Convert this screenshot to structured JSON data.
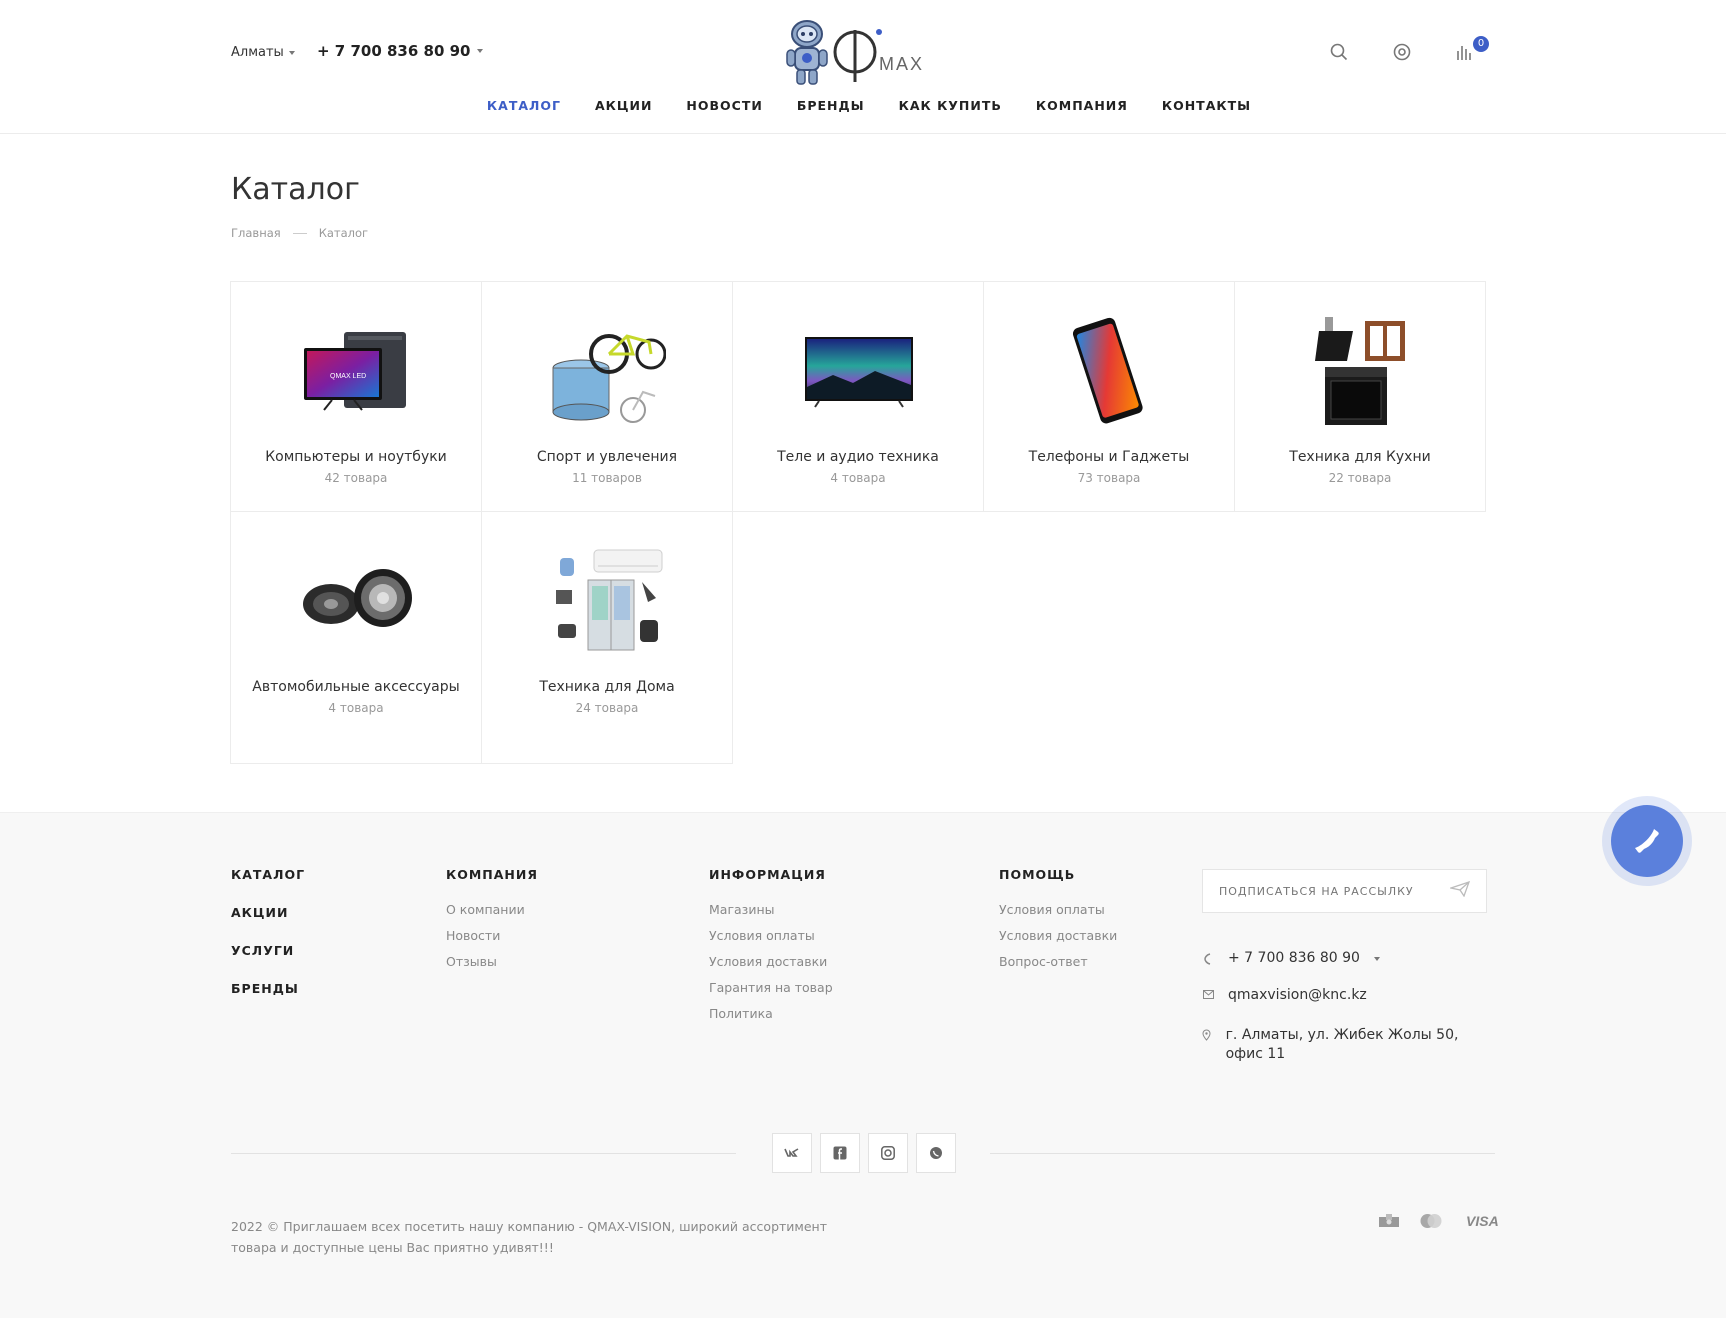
{
  "header": {
    "city": "Алматы",
    "phone": "+ 7 700 836 80 90",
    "cart_count": "0"
  },
  "nav": [
    {
      "label": "КАТАЛОГ",
      "active": true
    },
    {
      "label": "АКЦИИ"
    },
    {
      "label": "НОВОСТИ"
    },
    {
      "label": "БРЕНДЫ"
    },
    {
      "label": "КАК КУПИТЬ"
    },
    {
      "label": "КОМПАНИЯ"
    },
    {
      "label": "КОНТАКТЫ"
    }
  ],
  "page": {
    "title": "Каталог",
    "breadcrumb": [
      "Главная",
      "Каталог"
    ]
  },
  "categories": [
    {
      "name": "Компьютеры и ноутбуки",
      "count": "42 товара",
      "icon": "computer-icon"
    },
    {
      "name": "Спорт и увлечения",
      "count": "11 товаров",
      "icon": "sport-icon"
    },
    {
      "name": "Теле и аудио техника",
      "count": "4 товара",
      "icon": "tv-icon"
    },
    {
      "name": "Телефоны и Гаджеты",
      "count": "73 товара",
      "icon": "phone-icon"
    },
    {
      "name": "Техника для Кухни",
      "count": "22 товара",
      "icon": "kitchen-icon"
    },
    {
      "name": "Автомобильные аксессуары",
      "count": "4 товара",
      "icon": "speaker-icon"
    },
    {
      "name": "Техника для Дома",
      "count": "24 товара",
      "icon": "home-appliance-icon"
    }
  ],
  "footer": {
    "col1": [
      "КАТАЛОГ",
      "АКЦИИ",
      "УСЛУГИ",
      "БРЕНДЫ"
    ],
    "col2": {
      "head": "КОМПАНИЯ",
      "links": [
        "О компании",
        "Новости",
        "Отзывы"
      ]
    },
    "col3": {
      "head": "ИНФОРМАЦИЯ",
      "links": [
        "Магазины",
        "Условия оплаты",
        "Условия доставки",
        "Гарантия на товар",
        "Политика"
      ]
    },
    "col4": {
      "head": "ПОМОЩЬ",
      "links": [
        "Условия оплаты",
        "Условия доставки",
        "Вопрос-ответ"
      ]
    },
    "subscribe_placeholder": "ПОДПИСАТЬСЯ НА РАССЫЛКУ",
    "phone": "+ 7 700 836 80 90",
    "email": "qmaxvision@knc.kz",
    "address": "г. Алматы, ул. Жибек Жолы 50, офис 11",
    "copyright": "2022 © Приглашаем всех посетить нашу компанию - QMAX-VISION, широкий ассортимент товара и доступные цены Вас приятно удивят!!!",
    "visa_label": "VISA"
  },
  "colors": {
    "accent": "#3d5ec7",
    "call_button": "#5b80dc"
  }
}
